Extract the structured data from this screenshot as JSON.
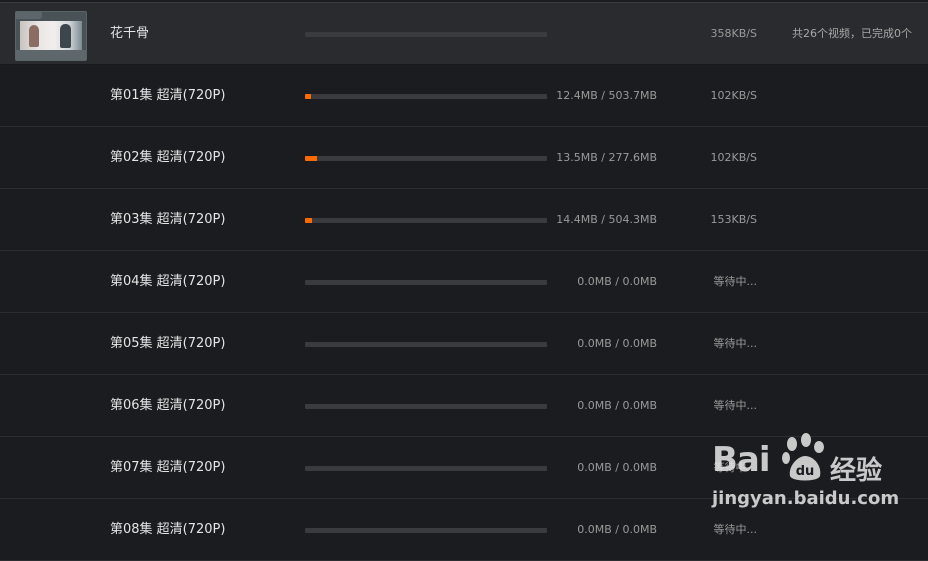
{
  "group": {
    "title": "花千骨",
    "speed": "358KB/S",
    "summary": "共26个视频，已完成0个",
    "progress": 0
  },
  "episodes": [
    {
      "label": "第01集 超清(720P)",
      "size": "12.4MB / 503.7MB",
      "status": "102KB/S",
      "progress": 0.025
    },
    {
      "label": "第02集 超清(720P)",
      "size": "13.5MB / 277.6MB",
      "status": "102KB/S",
      "progress": 0.049
    },
    {
      "label": "第03集 超清(720P)",
      "size": "14.4MB / 504.3MB",
      "status": "153KB/S",
      "progress": 0.029
    },
    {
      "label": "第04集 超清(720P)",
      "size": "0.0MB / 0.0MB",
      "status": "等待中...",
      "progress": 0
    },
    {
      "label": "第05集 超清(720P)",
      "size": "0.0MB / 0.0MB",
      "status": "等待中...",
      "progress": 0
    },
    {
      "label": "第06集 超清(720P)",
      "size": "0.0MB / 0.0MB",
      "status": "等待中...",
      "progress": 0
    },
    {
      "label": "第07集 超清(720P)",
      "size": "0.0MB / 0.0MB",
      "status": "等待中...",
      "progress": 0
    },
    {
      "label": "第08集 超清(720P)",
      "size": "0.0MB / 0.0MB",
      "status": "等待中...",
      "progress": 0
    }
  ],
  "colors": {
    "accent": "#ff6a00",
    "background": "#1b1c1f",
    "header": "#2a2b2e"
  },
  "watermark": {
    "brand": "Bai",
    "brand2": "du",
    "cn": "经验",
    "url": "jingyan.baidu.com"
  }
}
